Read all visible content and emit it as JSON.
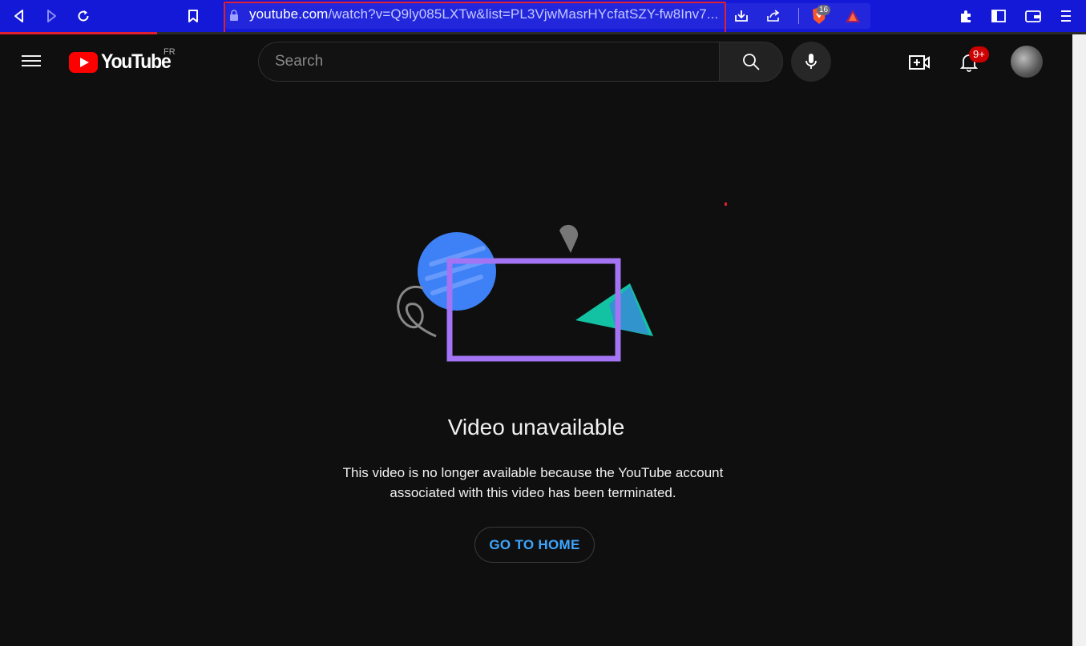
{
  "browser": {
    "url_domain": "youtube.com",
    "url_path": "/watch?v=Q9ly085LXTw&list=PL3VjwMasrHYcfatSZY-fw8Inv7...",
    "brave_shield_count": "16",
    "icons": [
      "back-icon",
      "forward-icon",
      "reload-icon",
      "bookmark-icon",
      "lock-icon",
      "download-icon",
      "share-icon",
      "brave-shield-icon",
      "brave-rewards-icon",
      "extensions-icon",
      "sidebar-icon",
      "wallet-icon",
      "menu-icon"
    ],
    "progress_fraction": 0.145
  },
  "header": {
    "logo_text": "YouTube",
    "region": "FR",
    "search_placeholder": "Search",
    "notification_count": "9+"
  },
  "main": {
    "title": "Video unavailable",
    "message_line1": "This video is no longer available because the YouTube account",
    "message_line2": "associated with this video has been terminated.",
    "home_button": "GO TO HOME"
  },
  "colors": {
    "browser_bar": "#1419d8",
    "highlight_box": "#e0202e",
    "background": "#0f0f0f",
    "link_blue": "#3ea6ff",
    "brand_red": "#ff0000"
  }
}
